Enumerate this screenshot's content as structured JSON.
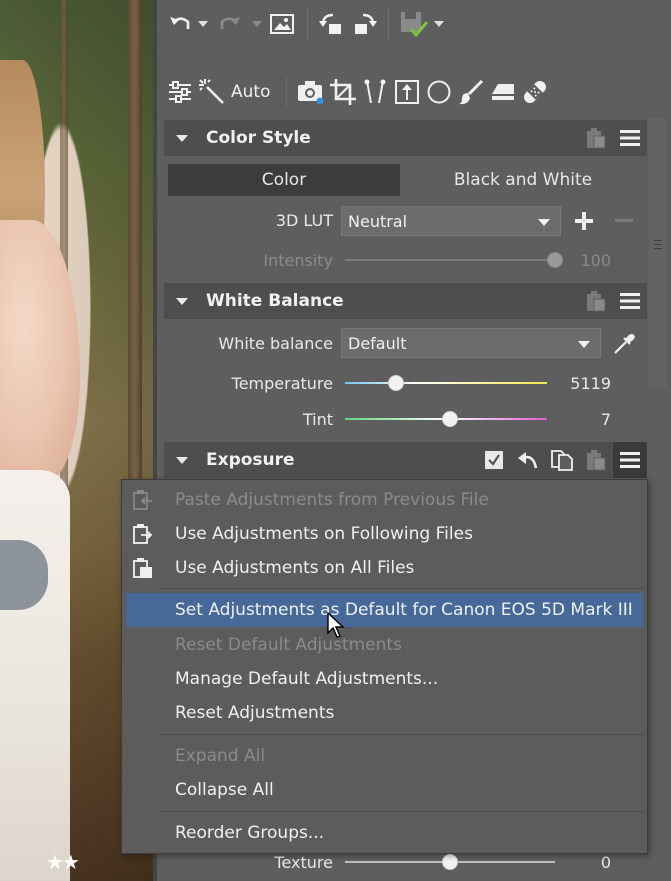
{
  "toolbar_top": {
    "icons": [
      "undo-icon",
      "undo-dropdown-icon",
      "redo-icon",
      "redo-dropdown-icon",
      "image-icon",
      "rotate-left-icon",
      "rotate-right-icon",
      "save-icon",
      "save-dropdown-icon"
    ]
  },
  "toolbar_tools": {
    "auto_label": "Auto",
    "icons": [
      "sliders-icon",
      "magic-wand-icon",
      "camera-icon",
      "crop-icon",
      "straighten-icon",
      "frame-icon",
      "circle-icon",
      "brush-icon",
      "eraser-icon",
      "bandage-icon"
    ]
  },
  "color_style": {
    "title": "Color Style",
    "tabs": [
      "Color",
      "Black and White"
    ],
    "active_tab": "Color",
    "lut_label": "3D LUT",
    "lut_value": "Neutral",
    "intensity_label": "Intensity",
    "intensity_value": "100",
    "intensity_level": 1.0
  },
  "white_balance": {
    "title": "White Balance",
    "wb_label": "White balance",
    "wb_value": "Default",
    "temperature_label": "Temperature",
    "temperature_value": "5119",
    "temperature_level": 0.25,
    "tint_label": "Tint",
    "tint_value": "7",
    "tint_level": 0.52
  },
  "exposure": {
    "title": "Exposure",
    "enabled": true
  },
  "context_menu": {
    "items": [
      {
        "label": "Paste Adjustments from Previous File",
        "disabled": true,
        "icon": "paste-previous-icon"
      },
      {
        "label": "Use Adjustments on Following Files",
        "disabled": false,
        "icon": "copy-following-icon"
      },
      {
        "label": "Use Adjustments on All Files",
        "disabled": false,
        "icon": "copy-all-icon"
      },
      {
        "label": "Set Adjustments as Default for Canon EOS 5D Mark III",
        "disabled": false,
        "highlighted": true
      },
      {
        "label": "Reset Default Adjustments",
        "disabled": true
      },
      {
        "label": "Manage Default Adjustments...",
        "disabled": false
      },
      {
        "label": "Reset Adjustments",
        "disabled": false
      },
      {
        "label": "Expand All",
        "disabled": true
      },
      {
        "label": "Collapse All",
        "disabled": false
      },
      {
        "label": "Reorder Groups...",
        "disabled": false
      }
    ]
  },
  "detail": {
    "texture_label": "Texture",
    "texture_value": "0",
    "texture_level": 0.5
  },
  "photo": {
    "rating_stars": "★★"
  },
  "colors": {
    "panel_bg": "#5e5e5e",
    "section_header_bg": "#4e4e4e",
    "highlight": "#46699a",
    "active_tab_bg": "#3c3c3c"
  }
}
